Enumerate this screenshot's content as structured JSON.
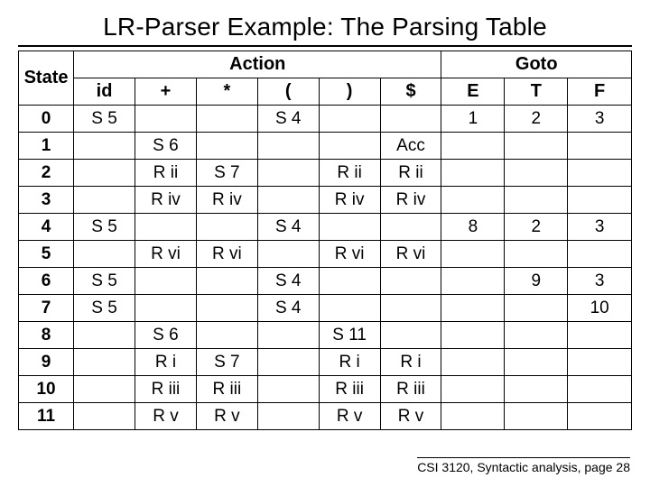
{
  "title": "LR-Parser Example: The Parsing Table",
  "header": {
    "state": "State",
    "action": "Action",
    "goto": "Goto",
    "cols": {
      "id": "id",
      "plus": "+",
      "star": "*",
      "lpar": "(",
      "rpar": ")",
      "dol": "$",
      "E": "E",
      "T": "T",
      "F": "F"
    }
  },
  "rows": [
    {
      "state": "0",
      "id": "S 5",
      "plus": "",
      "star": "",
      "lpar": "S 4",
      "rpar": "",
      "dol": "",
      "E": "1",
      "T": "2",
      "F": "3"
    },
    {
      "state": "1",
      "id": "",
      "plus": "S 6",
      "star": "",
      "lpar": "",
      "rpar": "",
      "dol": "Acc",
      "E": "",
      "T": "",
      "F": ""
    },
    {
      "state": "2",
      "id": "",
      "plus": "R ii",
      "star": "S 7",
      "lpar": "",
      "rpar": "R ii",
      "dol": "R ii",
      "E": "",
      "T": "",
      "F": ""
    },
    {
      "state": "3",
      "id": "",
      "plus": "R iv",
      "star": "R iv",
      "lpar": "",
      "rpar": "R iv",
      "dol": "R iv",
      "E": "",
      "T": "",
      "F": ""
    },
    {
      "state": "4",
      "id": "S 5",
      "plus": "",
      "star": "",
      "lpar": "S 4",
      "rpar": "",
      "dol": "",
      "E": "8",
      "T": "2",
      "F": "3"
    },
    {
      "state": "5",
      "id": "",
      "plus": "R vi",
      "star": "R vi",
      "lpar": "",
      "rpar": "R vi",
      "dol": "R vi",
      "E": "",
      "T": "",
      "F": ""
    },
    {
      "state": "6",
      "id": "S 5",
      "plus": "",
      "star": "",
      "lpar": "S 4",
      "rpar": "",
      "dol": "",
      "E": "",
      "T": "9",
      "F": "3"
    },
    {
      "state": "7",
      "id": "S 5",
      "plus": "",
      "star": "",
      "lpar": "S 4",
      "rpar": "",
      "dol": "",
      "E": "",
      "T": "",
      "F": "10"
    },
    {
      "state": "8",
      "id": "",
      "plus": "S 6",
      "star": "",
      "lpar": "",
      "rpar": "S 11",
      "dol": "",
      "E": "",
      "T": "",
      "F": ""
    },
    {
      "state": "9",
      "id": "",
      "plus": "R i",
      "star": "S 7",
      "lpar": "",
      "rpar": "R i",
      "dol": "R i",
      "E": "",
      "T": "",
      "F": ""
    },
    {
      "state": "10",
      "id": "",
      "plus": "R iii",
      "star": "R iii",
      "lpar": "",
      "rpar": "R iii",
      "dol": "R iii",
      "E": "",
      "T": "",
      "F": ""
    },
    {
      "state": "11",
      "id": "",
      "plus": "R v",
      "star": "R v",
      "lpar": "",
      "rpar": "R v",
      "dol": "R v",
      "E": "",
      "T": "",
      "F": ""
    }
  ],
  "footer": "CSI 3120, Syntactic analysis, page 28"
}
